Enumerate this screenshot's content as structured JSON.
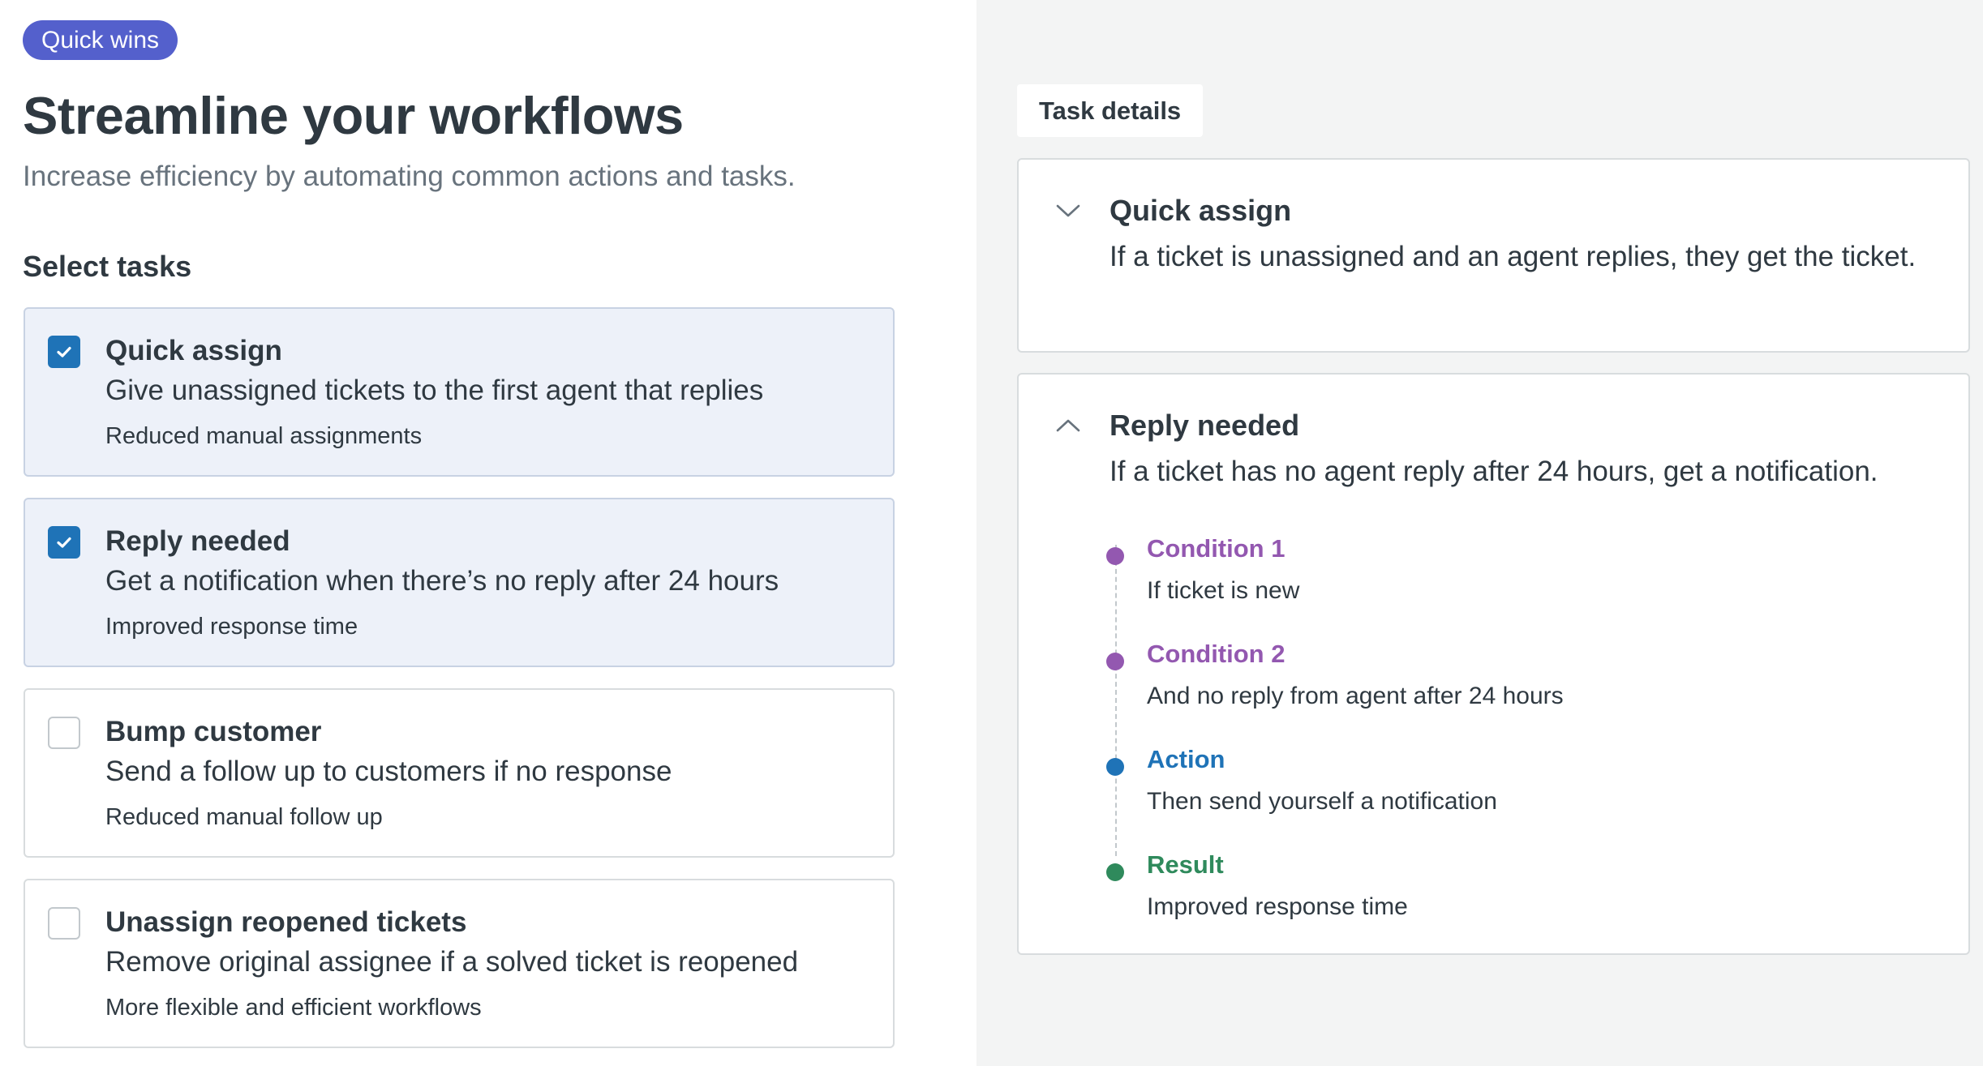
{
  "header": {
    "badge": "Quick wins",
    "title": "Streamline your workflows",
    "subtitle": "Increase efficiency by automating common actions and tasks."
  },
  "tasks_section": {
    "label": "Select tasks",
    "tasks": [
      {
        "name": "Quick assign",
        "description": "Give unassigned tickets to the first agent that replies",
        "benefit": "Reduced manual assignments",
        "checked": true
      },
      {
        "name": "Reply needed",
        "description": "Get a notification when there’s no reply after 24 hours",
        "benefit": "Improved response time",
        "checked": true
      },
      {
        "name": "Bump customer",
        "description": "Send a follow up to customers if no response",
        "benefit": "Reduced manual follow up",
        "checked": false
      },
      {
        "name": "Unassign reopened tickets",
        "description": "Remove original assignee if a solved ticket is reopened",
        "benefit": "More flexible and efficient workflows",
        "checked": false
      }
    ]
  },
  "details": {
    "tab_label": "Task details",
    "cards": [
      {
        "title": "Quick assign",
        "description": "If a ticket is unassigned and an agent replies, they get the ticket.",
        "expanded": false
      },
      {
        "title": "Reply needed",
        "description": "If a ticket has no agent reply after 24 hours, get a notification.",
        "expanded": true,
        "steps": [
          {
            "label": "Condition 1",
            "text": "If ticket is new",
            "color": "#9358b0"
          },
          {
            "label": "Condition 2",
            "text": "And no reply from agent after 24 hours",
            "color": "#9358b0"
          },
          {
            "label": "Action",
            "text": "Then send yourself a notification",
            "color": "#1f73b7"
          },
          {
            "label": "Result",
            "text": "Improved response time",
            "color": "#2f8a5c"
          }
        ]
      }
    ]
  },
  "colors": {
    "badge": "#5460cc",
    "checkbox_checked": "#1f73b7",
    "condition": "#9358b0",
    "action": "#1f73b7",
    "result": "#2f8a5c"
  }
}
